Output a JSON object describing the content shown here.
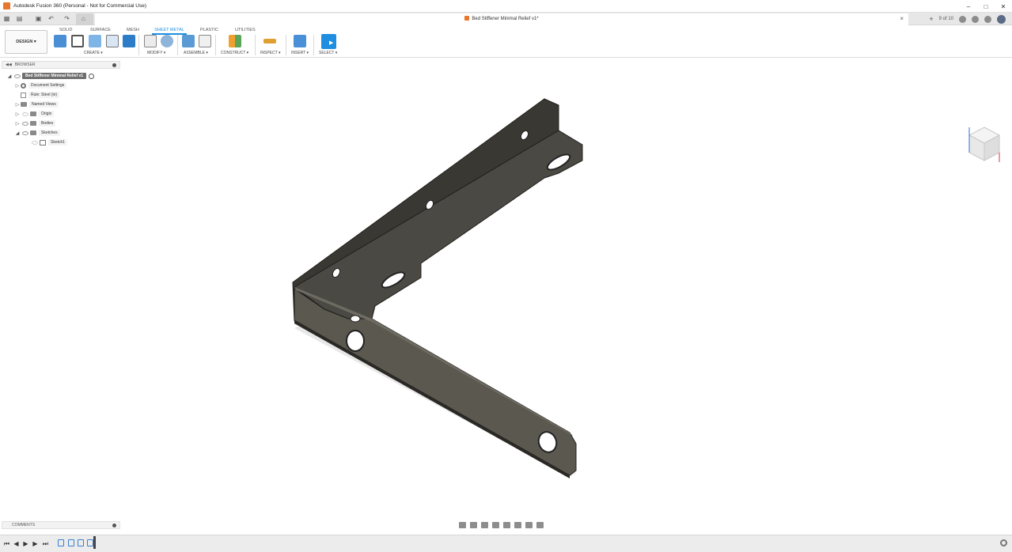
{
  "window": {
    "title": "Autodesk Fusion 360 (Personal - Not for Commercial Use)"
  },
  "tabs": {
    "document_title": "Bed Stiffener Minimal Relief v1*",
    "job_status": "9 of 10"
  },
  "toolbar": {
    "workspace": "DESIGN",
    "workspace_tabs": [
      "SOLID",
      "SURFACE",
      "MESH",
      "SHEET METAL",
      "PLASTIC",
      "UTILITIES"
    ],
    "active_tab": "SHEET METAL",
    "groups": [
      "CREATE",
      "MODIFY",
      "ASSEMBLE",
      "CONSTRUCT",
      "INSPECT",
      "INSERT",
      "SELECT"
    ]
  },
  "browser": {
    "header": "BROWSER",
    "root": "Bed Stiffener Minimal Relief v1",
    "items": [
      {
        "label": "Document Settings"
      },
      {
        "label": "Rule: Steel (in)"
      },
      {
        "label": "Named Views"
      },
      {
        "label": "Origin"
      },
      {
        "label": "Bodies"
      },
      {
        "label": "Sketches"
      },
      {
        "label": "Sketch1"
      }
    ]
  },
  "comments": {
    "label": "COMMENTS"
  },
  "colors": {
    "accent": "#1f8ee0",
    "part_face": "#58564f",
    "part_top": "#3c3a35",
    "part_edge": "#2b2925"
  }
}
